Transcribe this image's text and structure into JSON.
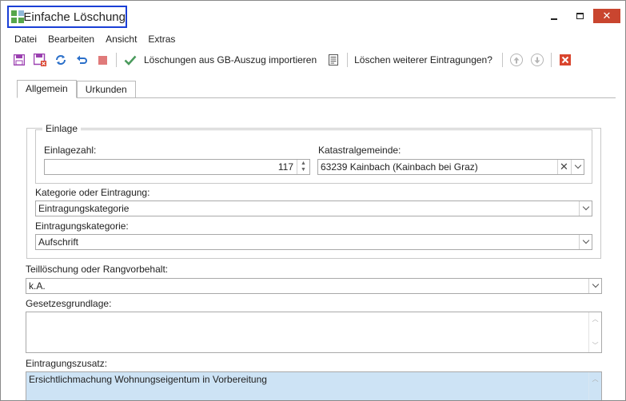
{
  "window": {
    "title": "Einfache Löschung",
    "close_glyph": "✕"
  },
  "menu": {
    "items": [
      "Datei",
      "Bearbeiten",
      "Ansicht",
      "Extras"
    ]
  },
  "toolbar": {
    "import_label": "Löschungen aus GB-Auszug importieren",
    "delete_more_label": "Löschen weiterer Eintragungen?",
    "icons": [
      "save-icon",
      "save-close-icon",
      "refresh-icon",
      "undo-icon",
      "stop-icon",
      "checkmark-icon",
      "document-list-icon",
      "arrow-up-circle-icon",
      "arrow-down-circle-icon",
      "close-red-icon"
    ],
    "colors": {
      "save": "#9b3fb0",
      "refresh": "#2a6fc9",
      "stop": "#d9534f",
      "check": "#4a9a5c",
      "close": "#d9452e"
    }
  },
  "tabs": [
    {
      "label": "Allgemein",
      "active": true
    },
    {
      "label": "Urkunden",
      "active": false
    }
  ],
  "einlage": {
    "legend": "Einlage",
    "einlagezahl_label": "Einlagezahl:",
    "einlagezahl_value": "117",
    "katastral_label": "Katastralgemeinde:",
    "katastral_value": "63239 Kainbach (Kainbach bei Graz)"
  },
  "kategorie": {
    "label": "Kategorie oder Eintragung:",
    "value": "Eintragungskategorie"
  },
  "eintragungskategorie": {
    "label": "Eintragungskategorie:",
    "value": "Aufschrift"
  },
  "teilloeschung": {
    "label": "Teillöschung oder Rangvorbehalt:",
    "value": "k.A."
  },
  "gesetzesgrundlage": {
    "label": "Gesetzesgrundlage:",
    "value": ""
  },
  "eintragungszusatz": {
    "label": "Eintragungszusatz:",
    "value": "Ersichtlichmachung Wohnungseigentum in Vorbereitung"
  }
}
